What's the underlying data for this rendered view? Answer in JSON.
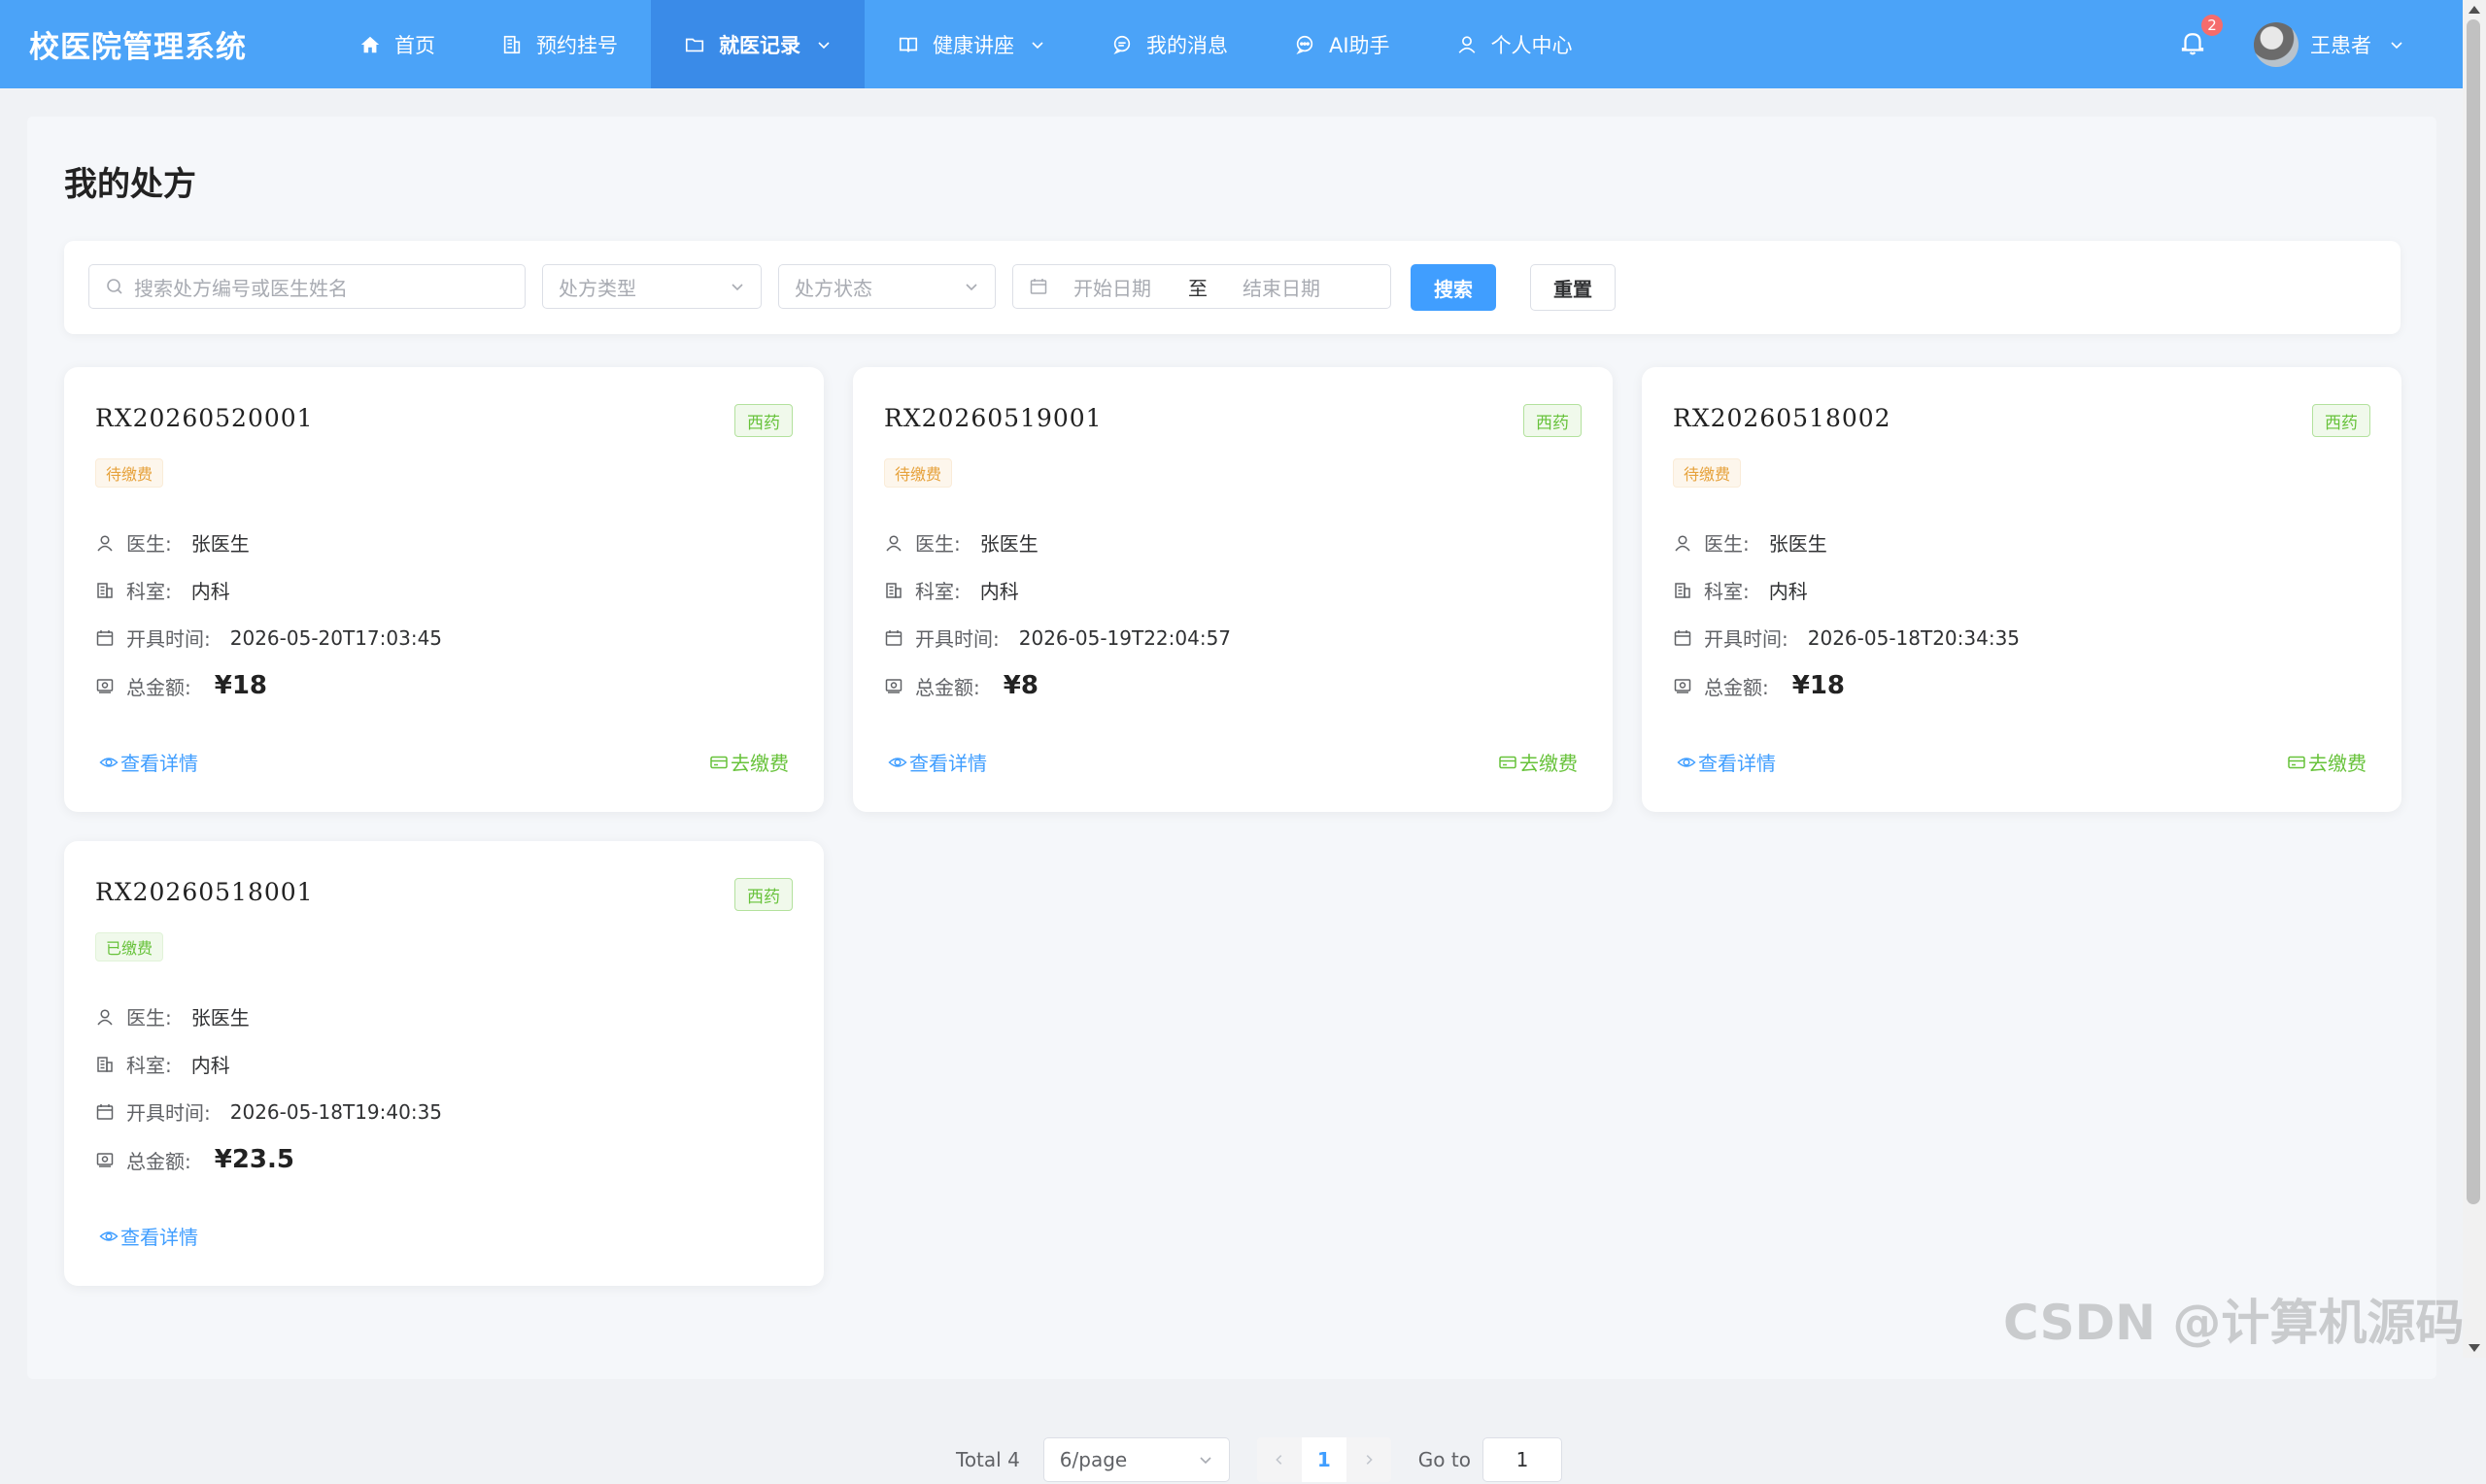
{
  "header": {
    "brand": "校医院管理系统",
    "nav": [
      {
        "label": "首页",
        "icon": "home-icon"
      },
      {
        "label": "预约挂号",
        "icon": "building-icon"
      },
      {
        "label": "就医记录",
        "icon": "folder-icon",
        "active": true,
        "dropdown": true
      },
      {
        "label": "健康讲座",
        "icon": "book-icon",
        "dropdown": true
      },
      {
        "label": "我的消息",
        "icon": "chat-icon"
      },
      {
        "label": "AI助手",
        "icon": "chat-dots-icon"
      },
      {
        "label": "个人中心",
        "icon": "user-icon"
      }
    ],
    "notification_count": "2",
    "user_name": "王患者"
  },
  "page": {
    "title": "我的处方"
  },
  "filters": {
    "search_placeholder": "搜索处方编号或医生姓名",
    "type_placeholder": "处方类型",
    "status_placeholder": "处方状态",
    "start_date_placeholder": "开始日期",
    "range_separator": "至",
    "end_date_placeholder": "结束日期",
    "search_button": "搜索",
    "reset_button": "重置"
  },
  "labels": {
    "doctor": "医生:",
    "dept": "科室:",
    "time": "开具时间:",
    "amount": "总金额:",
    "view_detail": "查看详情",
    "go_pay": "去缴费"
  },
  "prescriptions": [
    {
      "no": "RX20260520001",
      "type": "西药",
      "status": "待缴费",
      "doctor": "张医生",
      "dept": "内科",
      "time": "2026-05-20T17:03:45",
      "amount": "¥18"
    },
    {
      "no": "RX20260519001",
      "type": "西药",
      "status": "待缴费",
      "doctor": "张医生",
      "dept": "内科",
      "time": "2026-05-19T22:04:57",
      "amount": "¥8"
    },
    {
      "no": "RX20260518002",
      "type": "西药",
      "status": "待缴费",
      "doctor": "张医生",
      "dept": "内科",
      "time": "2026-05-18T20:34:35",
      "amount": "¥18"
    },
    {
      "no": "RX20260518001",
      "type": "西药",
      "status": "已缴费",
      "doctor": "张医生",
      "dept": "内科",
      "time": "2026-05-18T19:40:35",
      "amount": "¥23.5"
    }
  ],
  "pagination": {
    "total": "Total 4",
    "page_size": "6/page",
    "current_page": "1",
    "goto_label": "Go to",
    "goto_value": "1"
  },
  "watermark": "CSDN @计算机源码站",
  "colors": {
    "header_bg": "#4ba3f8",
    "header_active": "#3a8be8",
    "primary": "#409eff",
    "success": "#67c23a",
    "warning": "#e6a23c"
  }
}
